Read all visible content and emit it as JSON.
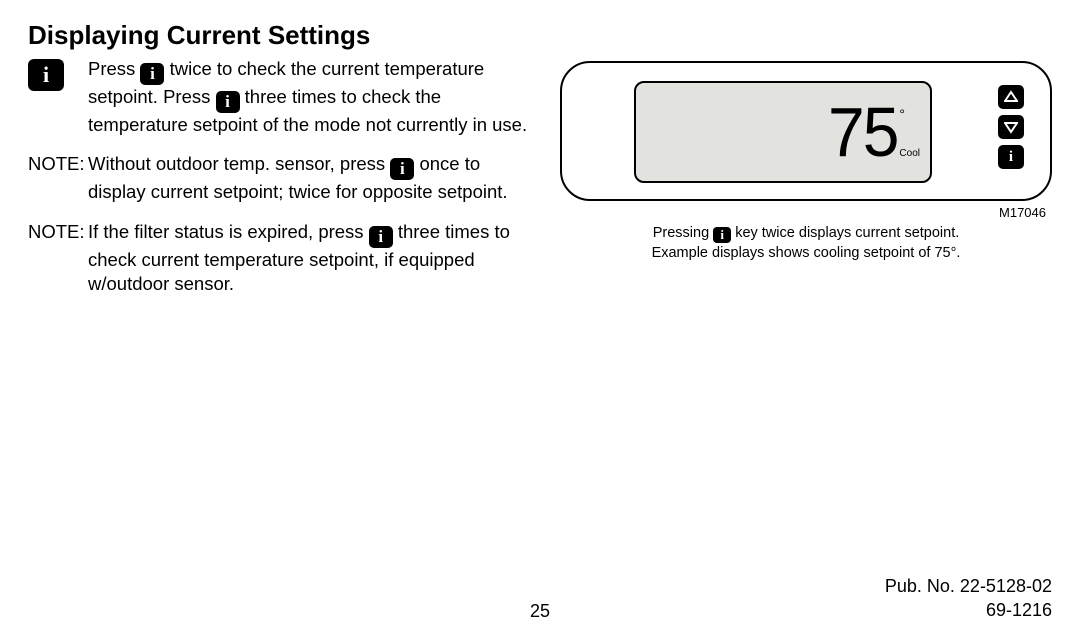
{
  "title": "Displaying Current Settings",
  "info_glyph": "i",
  "body": {
    "p1_a": "Press ",
    "p1_b": " twice to check the current temperature setpoint.  Press ",
    "p1_c": " three times to check the temperature setpoint of the mode not currently in use.",
    "note_label": "NOTE:",
    "p2_a": "Without outdoor temp. sensor, press ",
    "p2_b": " once to display current setpoint; twice for opposite setpoint.",
    "p3_a": "If the filter status is expired, press ",
    "p3_b": " three times to check current temperature setpoint, if equipped w/outdoor sensor."
  },
  "device": {
    "temperature": "75",
    "degree": "°",
    "mode": "Cool"
  },
  "figure": {
    "id": "M17046",
    "caption_a": "Pressing ",
    "caption_b": " key twice displays current setpoint.",
    "caption_c": "Example displays shows cooling setpoint of 75°."
  },
  "footer": {
    "page": "25",
    "pub": "Pub. No. 22-5128-02",
    "code": "69-1216"
  }
}
